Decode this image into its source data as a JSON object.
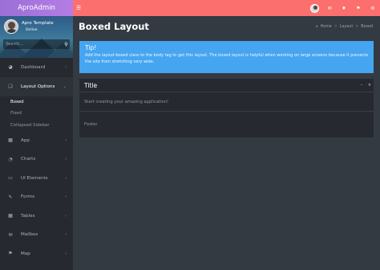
{
  "brand": {
    "name": "AproAdmin",
    "color": "#a873df"
  },
  "user": {
    "name": "Apro Template",
    "status": "Online"
  },
  "sidebar": {
    "search_placeholder": "Search...",
    "items": [
      {
        "label": "Dashboard",
        "icon": "dashboard-icon"
      },
      {
        "label": "Layout Options",
        "icon": "layout-icon",
        "expanded": true,
        "sub": [
          {
            "label": "Boxed",
            "current": true
          },
          {
            "label": "Fixed"
          },
          {
            "label": "Collapsed Sidebar"
          }
        ]
      },
      {
        "label": "App",
        "icon": "app-grid-icon"
      },
      {
        "label": "Charts",
        "icon": "pie-chart-icon"
      },
      {
        "label": "UI Elements",
        "icon": "laptop-icon"
      },
      {
        "label": "Forms",
        "icon": "pencil-icon"
      },
      {
        "label": "Tables",
        "icon": "table-icon"
      },
      {
        "label": "Mailbox",
        "icon": "envelope-icon"
      },
      {
        "label": "Map",
        "icon": "map-icon"
      }
    ]
  },
  "topbar": {
    "color": "#fb6f6f",
    "icons": [
      "menu-icon",
      "avatar",
      "mail-icon",
      "bell-icon",
      "flag-icon",
      "gear-icon"
    ]
  },
  "page": {
    "title": "Boxed Layout"
  },
  "breadcrumb": {
    "home": "Home",
    "section": "Layout",
    "current": "Boxed"
  },
  "callout": {
    "title": "Tip!",
    "text": "Add the layout-boxed class to the body tag to get this layout. The boxed layout is helpful when working on large screens because it prevents the site from stretching very wide.",
    "color": "#45a5f0"
  },
  "box": {
    "title": "Title",
    "body": "Start creating your amazing application!",
    "footer": "Footer"
  }
}
